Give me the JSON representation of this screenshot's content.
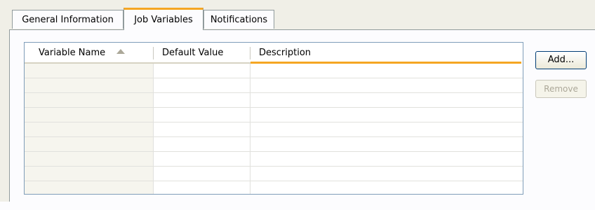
{
  "tabs": [
    {
      "label": "General Information",
      "active": false
    },
    {
      "label": "Job Variables",
      "active": true
    },
    {
      "label": "Notifications",
      "active": false
    }
  ],
  "table": {
    "columns": [
      {
        "label": "Variable Name",
        "sort": "ascending"
      },
      {
        "label": "Default Value"
      },
      {
        "label": "Description"
      }
    ],
    "rows": [
      [
        "",
        "",
        ""
      ],
      [
        "",
        "",
        ""
      ],
      [
        "",
        "",
        ""
      ],
      [
        "",
        "",
        ""
      ],
      [
        "",
        "",
        ""
      ],
      [
        "",
        "",
        ""
      ],
      [
        "",
        "",
        ""
      ],
      [
        "",
        "",
        ""
      ],
      [
        "",
        "",
        ""
      ]
    ]
  },
  "buttons": {
    "add_label": "Add...",
    "remove_label": "Remove",
    "remove_enabled": false
  },
  "colors": {
    "accent": "#f5a623",
    "border": "#7f9db9",
    "background": "#f0efe7"
  }
}
